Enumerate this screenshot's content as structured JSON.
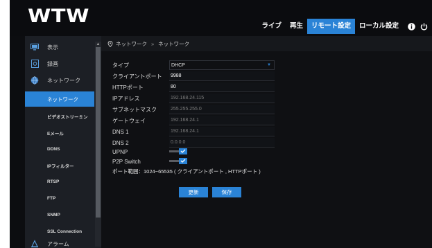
{
  "app": {
    "logo": "WTW"
  },
  "nav": {
    "items": [
      {
        "label": "ライブ"
      },
      {
        "label": "再生"
      },
      {
        "label": "リモート設定"
      },
      {
        "label": "ローカル設定"
      }
    ],
    "icons": [
      "info-icon",
      "power-icon"
    ]
  },
  "sidebar": {
    "items": [
      {
        "label": "表示",
        "icon": "monitor-icon"
      },
      {
        "label": "録画",
        "icon": "record-icon"
      },
      {
        "label": "ネットワーク",
        "icon": "globe-icon"
      },
      {
        "label": "ネットワーク"
      },
      {
        "label": "ビデオストリーミン"
      },
      {
        "label": "Eメール"
      },
      {
        "label": "DDNS"
      },
      {
        "label": "IPフィルター"
      },
      {
        "label": "RTSP"
      },
      {
        "label": "FTP"
      },
      {
        "label": "SNMP"
      },
      {
        "label": "SSL Connection"
      },
      {
        "label": "アラーム",
        "icon": "alarm-icon"
      }
    ]
  },
  "breadcrumb": {
    "parent": "ネットワーク",
    "separator": "»",
    "current": "ネットワーク"
  },
  "form": {
    "type": {
      "label": "タイプ",
      "value": "DHCP"
    },
    "client_port": {
      "label": "クライアントポート",
      "value": "9988"
    },
    "http_port": {
      "label": "HTTPポート",
      "value": "80"
    },
    "ip_address": {
      "label": "IPアドレス",
      "value": "192.168.24.115"
    },
    "subnet_mask": {
      "label": "サブネットマスク",
      "value": "255.255.255.0"
    },
    "gateway": {
      "label": "ゲートウェイ",
      "value": "192.168.24.1"
    },
    "dns1": {
      "label": "DNS 1",
      "value": "192.168.24.1"
    },
    "dns2": {
      "label": "DNS 2",
      "value": "0.0.0.0"
    },
    "upnp": {
      "label": "UPNP",
      "enabled": true
    },
    "p2p": {
      "label": "P2P Switch",
      "enabled": true
    },
    "port_note": "ポート範囲：1024~65535 ( クライアントポート , HTTPポート )"
  },
  "buttons": {
    "refresh": "更新",
    "save": "保存"
  },
  "colors": {
    "accent": "#2a83d6",
    "background": "#0c0d10",
    "sidebar": "#1c1f25"
  }
}
